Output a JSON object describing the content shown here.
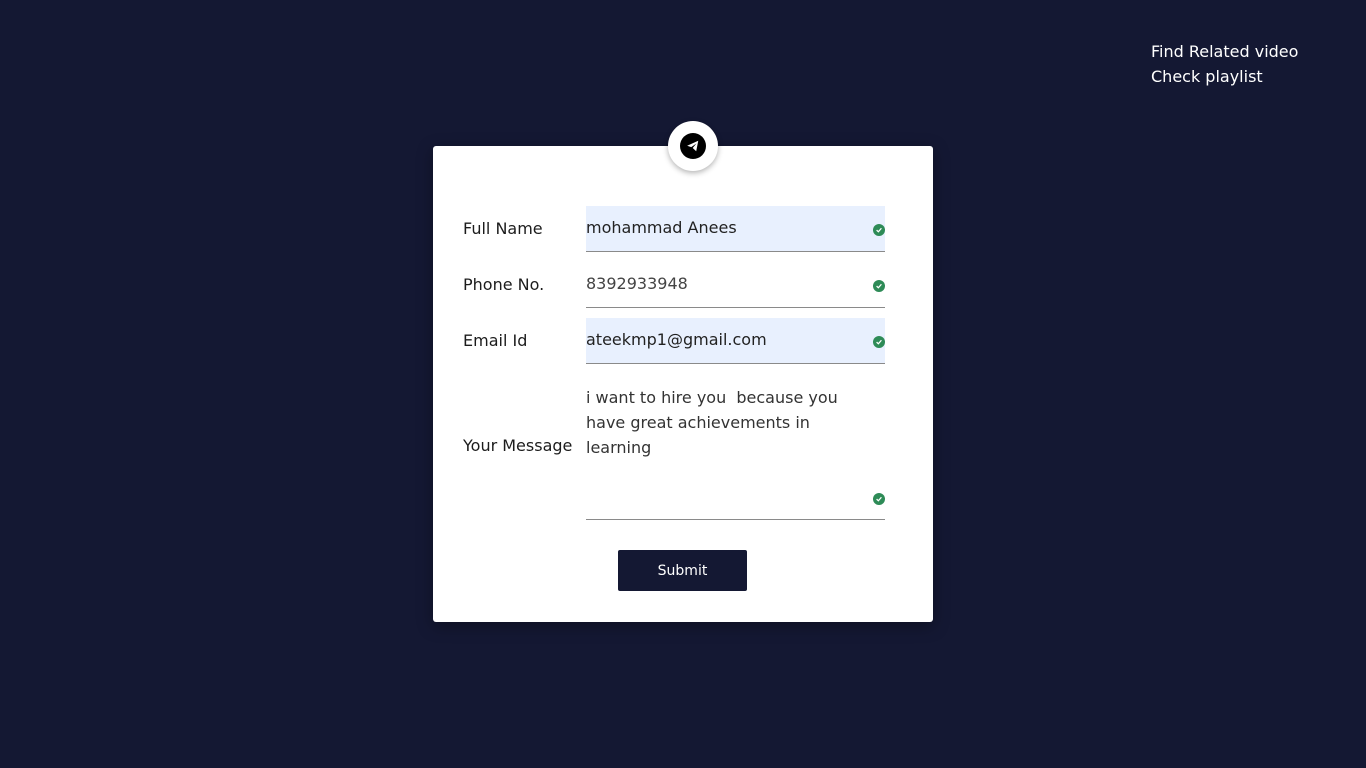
{
  "nav": {
    "links": [
      {
        "label": "Find Related video"
      },
      {
        "label": "Check playlist"
      }
    ]
  },
  "form": {
    "icon": "telegram-send-icon",
    "fields": [
      {
        "label": "Full Name",
        "value": "mohammad Anees",
        "valid": true
      },
      {
        "label": "Phone No.",
        "value": "8392933948",
        "valid": true
      },
      {
        "label": "Email Id",
        "value": "ateekmp1@gmail.com",
        "valid": true
      },
      {
        "label": "Your Message",
        "value": "i want to hire you  because you have great achievements in learning",
        "valid": true
      }
    ],
    "submit_label": "Submit"
  },
  "colors": {
    "background": "#141833",
    "card": "#ffffff",
    "autofill": "#e8f0fe",
    "valid": "#2e8b57",
    "button": "#141833"
  }
}
